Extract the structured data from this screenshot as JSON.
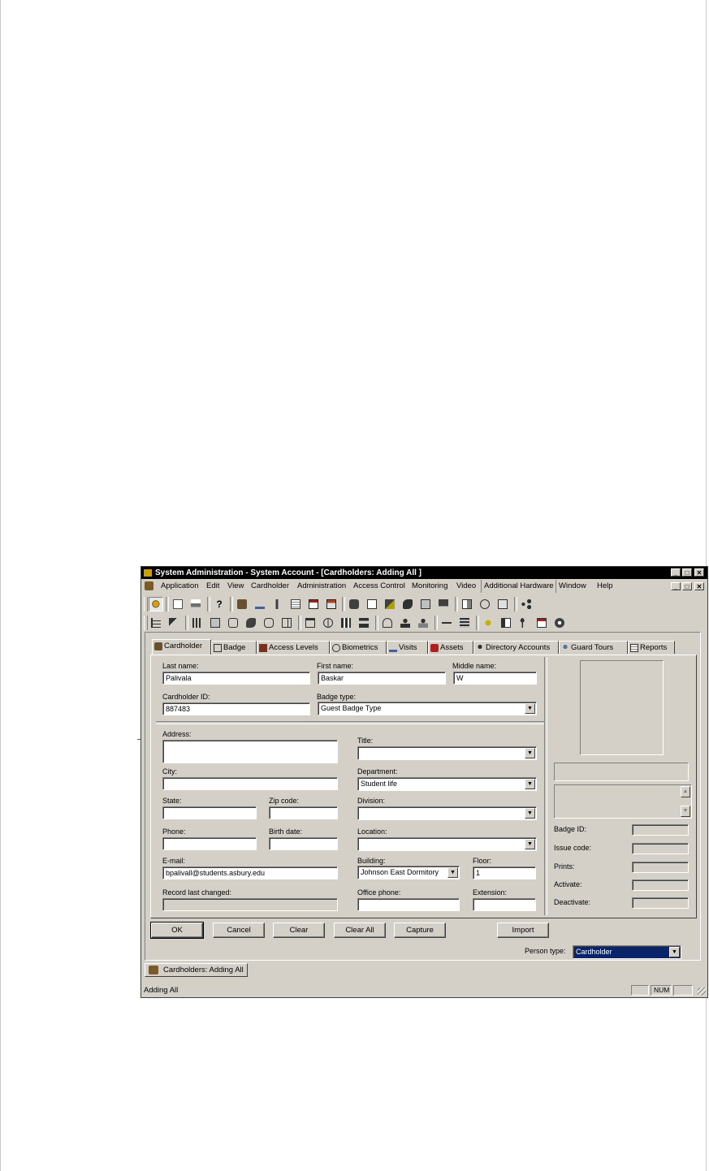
{
  "window": {
    "title": "System Administration - System Account - [Cardholders: Adding All ]",
    "min_glyph": "_",
    "max_glyph": "□",
    "close_glyph": "✕",
    "restore_glyph": "🗗"
  },
  "menu": [
    "Application",
    "Edit",
    "View",
    "Cardholder",
    "Administration",
    "Access Control",
    "Monitoring",
    "Video",
    "Additional Hardware",
    "Window",
    "Help"
  ],
  "tabs": [
    "Cardholder",
    "Badge",
    "Access Levels",
    "Biometrics",
    "Visits",
    "Assets",
    "Directory Accounts",
    "Guard Tours",
    "Reports"
  ],
  "form": {
    "last_name_label": "Last name:",
    "last_name": "Palivala",
    "first_name_label": "First name:",
    "first_name": "Baskar",
    "middle_name_label": "Middle name:",
    "middle_name": "W",
    "cardholder_id_label": "Cardholder ID:",
    "cardholder_id": "887483",
    "badge_type_label": "Badge type:",
    "badge_type": "Guest Badge Type",
    "address_label": "Address:",
    "address": "",
    "title_label": "Title:",
    "title": "",
    "city_label": "City:",
    "city": "",
    "department_label": "Department:",
    "department": "Student life",
    "state_label": "State:",
    "state": "",
    "zip_label": "Zip code:",
    "zip": "",
    "division_label": "Division:",
    "division": "",
    "phone_label": "Phone:",
    "phone": "",
    "birth_label": "Birth date:",
    "birth": "",
    "location_label": "Location:",
    "location": "",
    "email_label": "E-mail:",
    "email": "bpalivall@students.asbury.edu",
    "building_label": "Building:",
    "building": "Johnson East Dormitory",
    "floor_label": "Floor:",
    "floor": "1",
    "record_label": "Record last changed:",
    "record": "",
    "office_phone_label": "Office phone:",
    "office_phone": "",
    "extension_label": "Extension:",
    "extension": ""
  },
  "badge_info": {
    "badge_id_label": "Badge ID:",
    "issue_code_label": "Issue code:",
    "prints_label": "Prints:",
    "activate_label": "Activate:",
    "deactivate_label": "Deactivate:"
  },
  "buttons": {
    "ok": "OK",
    "cancel": "Cancel",
    "clear": "Clear",
    "clear_all": "Clear All",
    "capture": "Capture",
    "import": "Import"
  },
  "person_type": {
    "label": "Person type:",
    "value": "Cardholder"
  },
  "doc_tab": "Cardholders: Adding All",
  "status": {
    "text": "Adding All",
    "num": "NUM"
  },
  "colors": {
    "title_bg": "#000000",
    "face": "#d4d0c8",
    "selection": "#0a246a"
  }
}
